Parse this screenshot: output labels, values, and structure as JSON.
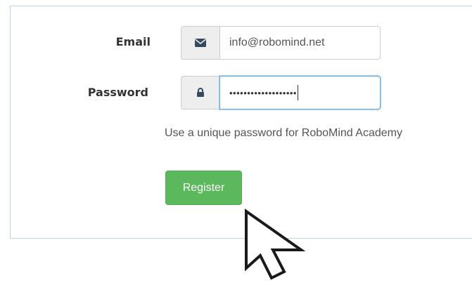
{
  "form": {
    "email": {
      "label": "Email",
      "icon": "envelope-icon",
      "value": "info@robomind.net"
    },
    "password": {
      "label": "Password",
      "icon": "lock-icon",
      "masked_value": "•••••••••••••••••••"
    },
    "help_text": "Use a unique password for RoboMind Academy",
    "submit_label": "Register"
  },
  "colors": {
    "label_text": "#333333",
    "button_bg": "#5cb85c",
    "focus_border": "#66afe9",
    "addon_bg": "#eeeeee",
    "panel_border": "#bcd3e6"
  }
}
